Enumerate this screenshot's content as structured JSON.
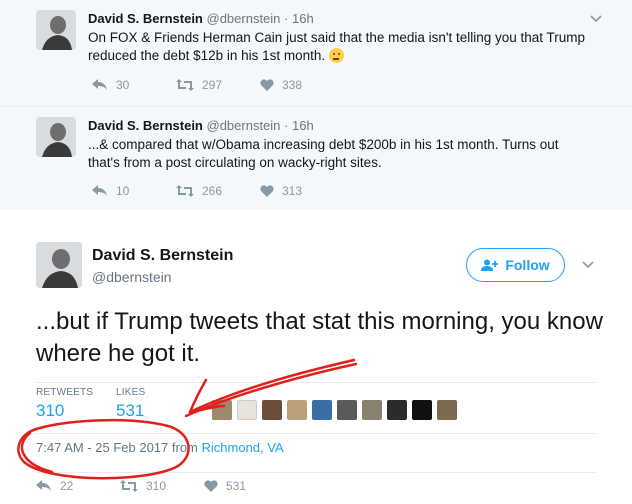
{
  "thread": [
    {
      "name": "David S. Bernstein",
      "handle": "@dbernstein",
      "time": "16h",
      "text": "On FOX & Friends Herman Cain just said that the media isn't telling you that Trump reduced the debt $12b in his 1st month.",
      "emoji": "thinking-face",
      "replies": "30",
      "retweets": "297",
      "likes": "338"
    },
    {
      "name": "David S. Bernstein",
      "handle": "@dbernstein",
      "time": "16h",
      "text": "...& compared that w/Obama increasing debt $200b in his 1st month. Turns out that's from a post circulating on wacky-right sites.",
      "replies": "10",
      "retweets": "266",
      "likes": "313"
    }
  ],
  "main": {
    "name": "David S. Bernstein",
    "handle": "@dbernstein",
    "follow_label": "Follow",
    "text": "...but if Trump tweets that stat this morning, you know where he got it.",
    "stats": {
      "retweets_label": "RETWEETS",
      "retweets": "310",
      "likes_label": "LIKES",
      "likes": "531"
    },
    "timestamp": "7:47 AM - 25 Feb 2017",
    "from": "from",
    "location": "Richmond, VA",
    "replies": "22",
    "retweets": "310",
    "likes": "531"
  },
  "colors": {
    "accent": "#1da1f2",
    "muted": "#657786",
    "annotation": "#e0201b"
  },
  "icons": [
    "chevron-down-icon",
    "reply-icon",
    "retweet-icon",
    "heart-icon",
    "follow-user-icon"
  ]
}
